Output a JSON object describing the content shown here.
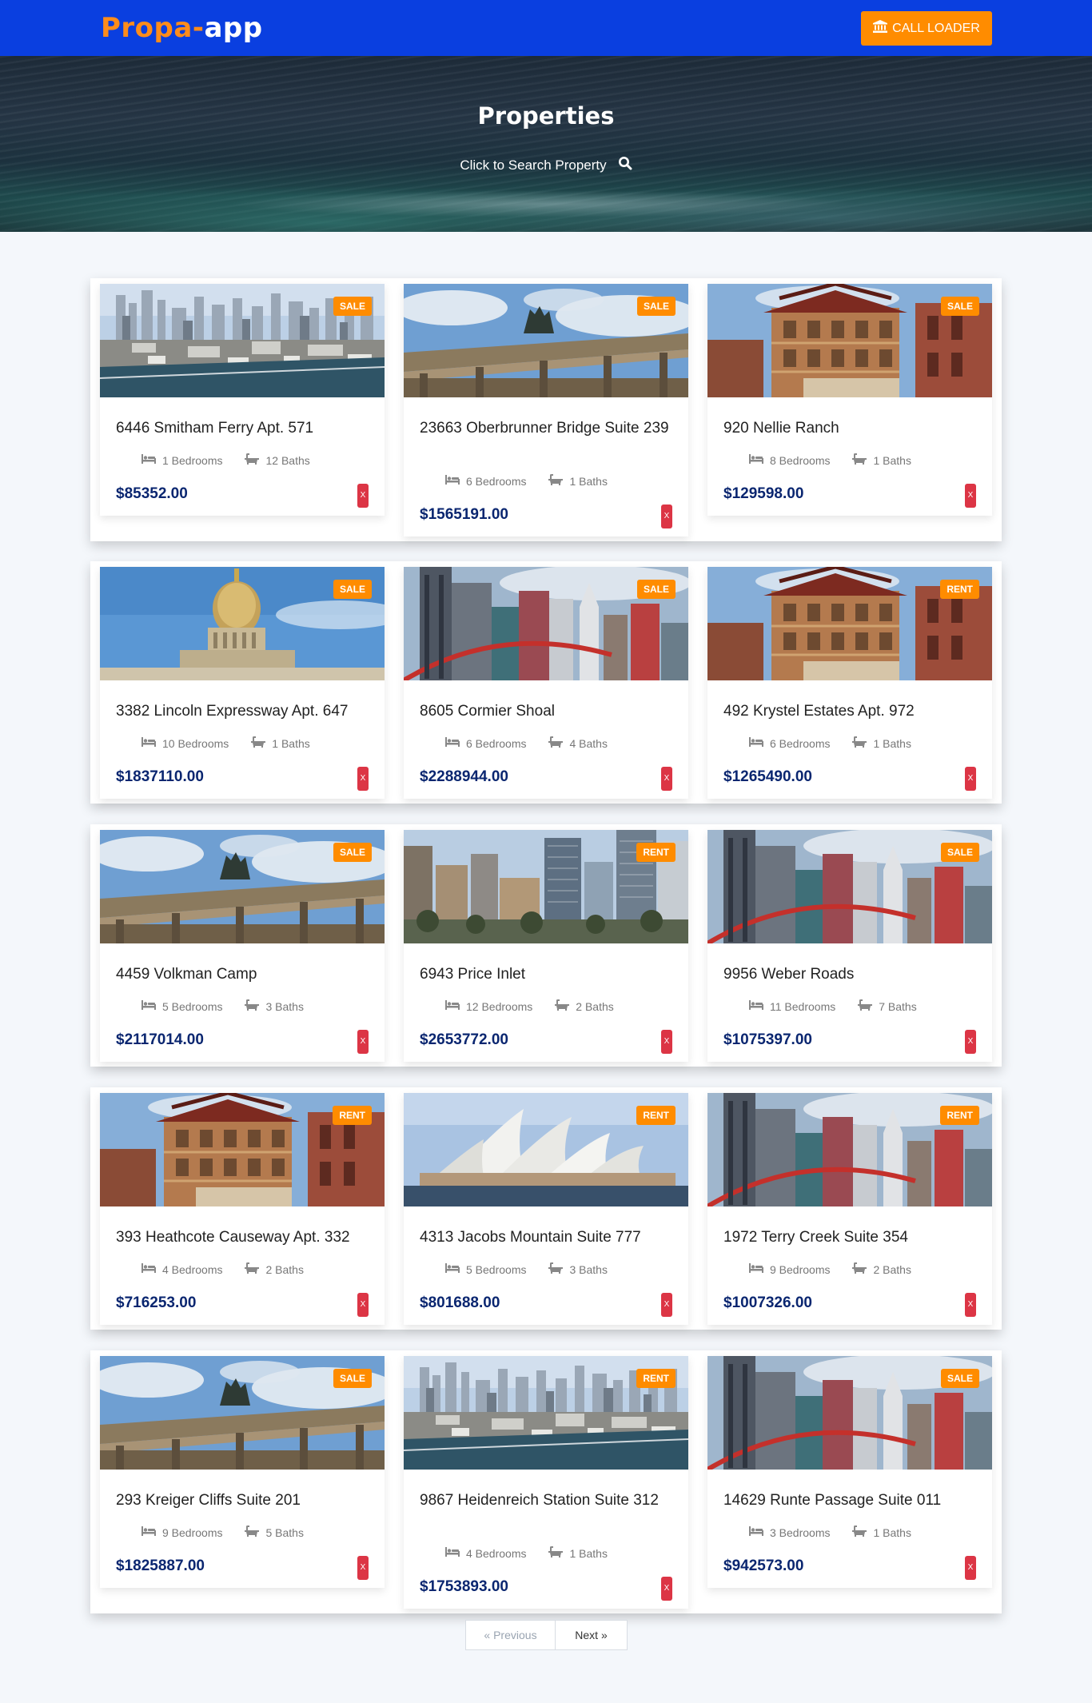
{
  "navbar": {
    "brand_part1": "Propa-",
    "brand_part2": "app",
    "call_button_label": "CALL LOADER",
    "call_button_icon": "bank-icon"
  },
  "hero": {
    "title": "Properties",
    "search_label": "Click to Search Property",
    "search_icon": "search-icon"
  },
  "listings": [
    {
      "address": "6446 Smitham Ferry Apt. 571",
      "bedrooms": "1 Bedrooms",
      "baths": "12 Baths",
      "price": "$85352.00",
      "badge": "SALE",
      "image": "city-skyline"
    },
    {
      "address": "23663 Oberbrunner Bridge Suite 239",
      "bedrooms": "6 Bedrooms",
      "baths": "1 Baths",
      "price": "$1565191.00",
      "badge": "SALE",
      "image": "brandenburg-gate"
    },
    {
      "address": "920 Nellie Ranch",
      "bedrooms": "8 Bedrooms",
      "baths": "1 Baths",
      "price": "$129598.00",
      "badge": "SALE",
      "image": "pagoda-building"
    },
    {
      "address": "3382 Lincoln Expressway Apt. 647",
      "bedrooms": "10 Bedrooms",
      "baths": "1 Baths",
      "price": "$1837110.00",
      "badge": "SALE",
      "image": "golden-dome"
    },
    {
      "address": "8605 Cormier Shoal",
      "bedrooms": "6 Bedrooms",
      "baths": "4 Baths",
      "price": "$2288944.00",
      "badge": "SALE",
      "image": "casino-towers"
    },
    {
      "address": "492 Krystel Estates Apt. 972",
      "bedrooms": "6 Bedrooms",
      "baths": "1 Baths",
      "price": "$1265490.00",
      "badge": "RENT",
      "image": "pagoda-building"
    },
    {
      "address": "4459 Volkman Camp",
      "bedrooms": "5 Bedrooms",
      "baths": "3 Baths",
      "price": "$2117014.00",
      "badge": "SALE",
      "image": "brandenburg-gate"
    },
    {
      "address": "6943 Price Inlet",
      "bedrooms": "12 Bedrooms",
      "baths": "2 Baths",
      "price": "$2653772.00",
      "badge": "RENT",
      "image": "downtown-towers"
    },
    {
      "address": "9956 Weber Roads",
      "bedrooms": "11 Bedrooms",
      "baths": "7 Baths",
      "price": "$1075397.00",
      "badge": "SALE",
      "image": "casino-towers"
    },
    {
      "address": "393 Heathcote Causeway Apt. 332",
      "bedrooms": "4 Bedrooms",
      "baths": "2 Baths",
      "price": "$716253.00",
      "badge": "RENT",
      "image": "pagoda-building"
    },
    {
      "address": "4313 Jacobs Mountain Suite 777",
      "bedrooms": "5 Bedrooms",
      "baths": "3 Baths",
      "price": "$801688.00",
      "badge": "RENT",
      "image": "opera-house"
    },
    {
      "address": "1972 Terry Creek Suite 354",
      "bedrooms": "9 Bedrooms",
      "baths": "2 Baths",
      "price": "$1007326.00",
      "badge": "RENT",
      "image": "casino-towers"
    },
    {
      "address": "293 Kreiger Cliffs Suite 201",
      "bedrooms": "9 Bedrooms",
      "baths": "5 Baths",
      "price": "$1825887.00",
      "badge": "SALE",
      "image": "brandenburg-gate"
    },
    {
      "address": "9867 Heidenreich Station Suite 312",
      "bedrooms": "4 Bedrooms",
      "baths": "1 Baths",
      "price": "$1753893.00",
      "badge": "RENT",
      "image": "city-skyline"
    },
    {
      "address": "14629 Runte Passage Suite 011",
      "bedrooms": "3 Bedrooms",
      "baths": "1 Baths",
      "price": "$942573.00",
      "badge": "SALE",
      "image": "casino-towers"
    }
  ],
  "card_icons": {
    "bed": "bed-icon",
    "bath": "bath-icon"
  },
  "delete_label": "X",
  "pagination": {
    "previous": "« Previous",
    "next": "Next »"
  },
  "colors": {
    "navbar": "#0a3fe0",
    "accent": "#ff8c00",
    "price": "#0a2670",
    "delete": "#dc3545"
  }
}
